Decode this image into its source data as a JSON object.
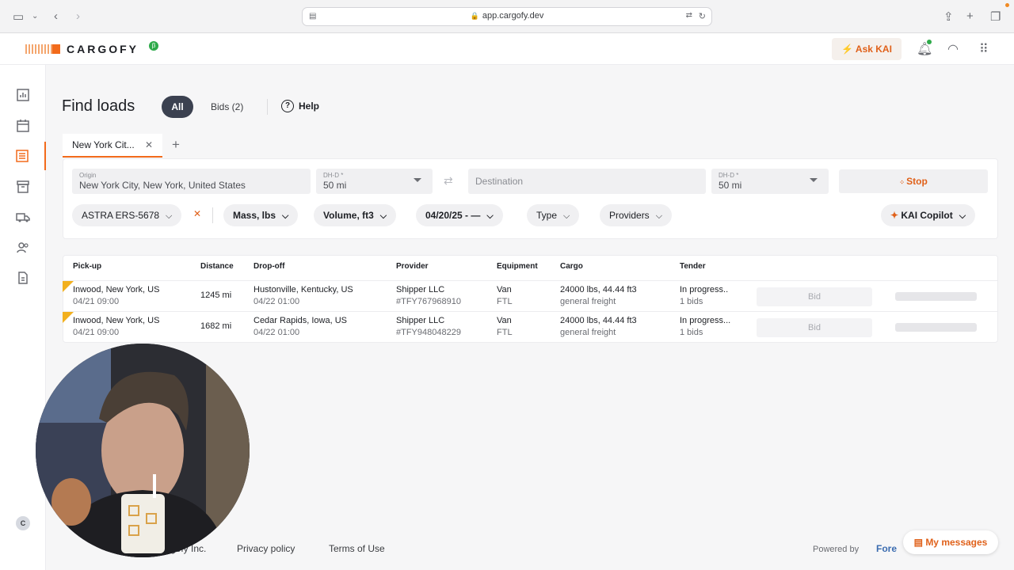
{
  "browser": {
    "url": "app.cargofy.dev"
  },
  "header": {
    "logo_text": "CARGOFY",
    "beta_badge": "β",
    "ask_kai_label": "Ask KAI"
  },
  "page": {
    "title": "Find loads",
    "filter_all": "All",
    "filter_bids": "Bids (2)",
    "help_label": "Help"
  },
  "search_tab": {
    "label": "New York Cit..."
  },
  "search_form": {
    "origin_label": "Origin",
    "origin_value": "New York City, New York, United States",
    "dhd_label": "DH-D *",
    "dhd_origin_value": "50 mi",
    "destination_placeholder": "Destination",
    "dhd_destination_value": "50 mi",
    "stop_label": "Stop"
  },
  "chips": {
    "truck": "ASTRA ERS-5678",
    "mass": "Mass, lbs",
    "volume": "Volume, ft3",
    "date": "04/20/25 - —",
    "type": "Type",
    "providers": "Providers",
    "copilot": "KAI Copilot"
  },
  "table": {
    "headers": [
      "Pick-up",
      "Distance",
      "Drop-off",
      "Provider",
      "Equipment",
      "Cargo",
      "Tender"
    ],
    "rows": [
      {
        "pickup": "Inwood, New York, US",
        "pickup_time": "04/21 09:00",
        "distance": "1245 mi",
        "dropoff": "Hustonville, Kentucky, US",
        "dropoff_time": "04/22 01:00",
        "provider": "Shipper LLC",
        "provider_id": "#TFY767968910",
        "equipment": "Van",
        "equipment_type": "FTL",
        "cargo": "24000 lbs, 44.44 ft3",
        "cargo_type": "general freight",
        "tender": "In progress..",
        "tender_bids": "1 bids",
        "bid_label": "Bid"
      },
      {
        "pickup": "Inwood, New York, US",
        "pickup_time": "04/21 09:00",
        "distance": "1682 mi",
        "dropoff": "Cedar Rapids, Iowa, US",
        "dropoff_time": "04/22 01:00",
        "provider": "Shipper LLC",
        "provider_id": "#TFY948048229",
        "equipment": "Van",
        "equipment_type": "FTL",
        "cargo": "24000 lbs, 44.44 ft3",
        "cargo_type": "general freight",
        "tender": "In progress...",
        "tender_bids": "1 bids",
        "bid_label": "Bid"
      }
    ]
  },
  "sidebar": {
    "user_initial": "C"
  },
  "footer": {
    "company": "gofy Inc.",
    "privacy": "Privacy policy",
    "terms": "Terms of Use",
    "powered_by": "Powered by",
    "powered_brand": "Fore",
    "messages": "My messages"
  },
  "colors": {
    "accent": "#f26a1b",
    "pill_active": "#3b4150",
    "flag": "#f2b01e"
  }
}
